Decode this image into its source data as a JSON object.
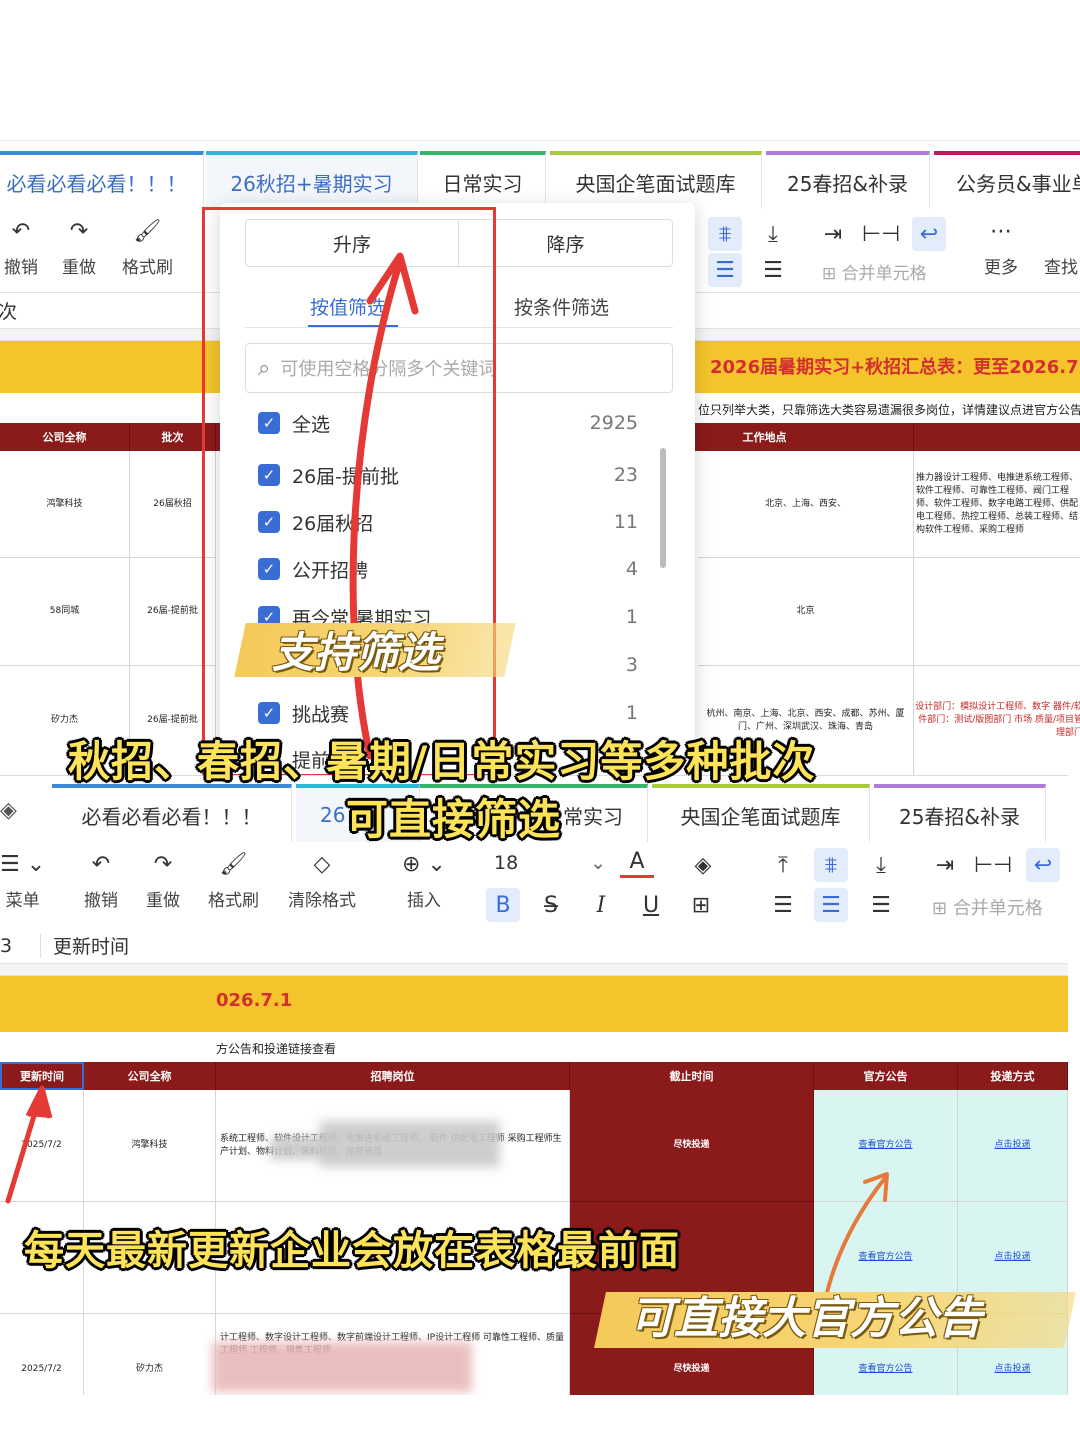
{
  "top_panel": {
    "tabs": [
      {
        "label": "必看必看必看！！！",
        "color": "#3b8bd9"
      },
      {
        "label": "26秋招+暑期实习",
        "color": "#2fb6d8",
        "active": true
      },
      {
        "label": "日常实习",
        "color": "#36b46b"
      },
      {
        "label": "央国企笔面试题库",
        "color": "#a8c93b"
      },
      {
        "label": "25春招&补录",
        "color": "#b07ad8"
      },
      {
        "label": "公务员&事业单",
        "color": "#c2185b"
      }
    ],
    "toolbar": {
      "undo": "撤销",
      "redo": "重做",
      "format_painter": "格式刷",
      "merge_cells": "合并单元格",
      "more": "更多",
      "find": "查找"
    },
    "formula_text": "次",
    "title_banner": "2026届暑期实习+秋招汇总表：更至2026.7.",
    "subtitle": "位只列举大类，只靠筛选大类容易遗漏很多岗位，详情建议点进官方公告和投",
    "headers": [
      "公司全称",
      "批次",
      "工作地点"
    ],
    "rows": [
      {
        "company": "鸿擎科技",
        "batch": "26届秋招",
        "location": "北京、上海、西安、",
        "jobs": "推力器设计工程师、电推进系统工程师、软件工程师、可靠性工程师、阀门工程师、软件工程师、数字电路工程师、供配电工程师、热控工程师、总装工程师、结构软件工程师、采购工程师"
      },
      {
        "company": "58同城",
        "batch": "26届-提前批",
        "location": "北京",
        "jobs": ""
      },
      {
        "company": "矽力杰",
        "batch": "26届-提前批",
        "location": "杭州、南京、上海、北京、西安、成都、苏州、厦门、广州、深圳武汉、珠海、青岛",
        "jobs": "设计部门：模拟设计工程师、数字 器件/软件部门：测试/版图部门 市场 质量/项目管理部门"
      }
    ],
    "filter_popup": {
      "sort_asc": "升序",
      "sort_desc": "降序",
      "tab_by_value": "按值筛选",
      "tab_by_condition": "按条件筛选",
      "search_placeholder": "可使用空格分隔多个关键词",
      "items": [
        {
          "label": "全选",
          "count": "2925"
        },
        {
          "label": "26届-提前批",
          "count": "23"
        },
        {
          "label": "26届秋招",
          "count": "11"
        },
        {
          "label": "公开招聘",
          "count": "4"
        },
        {
          "label": "再今常/暑期实习",
          "count": "1"
        },
        {
          "label": "",
          "count": "3"
        },
        {
          "label": "挑战赛",
          "count": "1"
        },
        {
          "label": "提前",
          "count": ""
        }
      ]
    },
    "overlay_ribbon": "支持筛选"
  },
  "bottom_panel": {
    "tabs": [
      {
        "label": "必看必看必看！！！",
        "color": "#3b8bd9"
      },
      {
        "label": "26",
        "color": "#2fb6d8",
        "active": true
      },
      {
        "label": "常实习",
        "color": "#36b46b"
      },
      {
        "label": "央国企笔面试题库",
        "color": "#a8c93b"
      },
      {
        "label": "25春招&补录",
        "color": "#b07ad8"
      }
    ],
    "toolbar": {
      "menu": "菜单",
      "undo": "撤销",
      "redo": "重做",
      "format_painter": "格式刷",
      "clear_format": "清除格式",
      "insert": "插入",
      "font_size": "18",
      "merge_cells": "合并单元格"
    },
    "cell_ref": "3",
    "formula_text": "更新时间",
    "title_banner": "026.7.1",
    "subtitle": "方公告和投递链接查看",
    "headers": [
      "更新时间",
      "公司全称",
      "招聘岗位",
      "截止时间",
      "官方公告",
      "投递方式"
    ],
    "rows": [
      {
        "date": "2025/7/2",
        "company": "鸿擎科技",
        "jobs": "系统工程师、软件设计工程师、电推进系统工程师、 软件 供配电工程师 采购工程师生产计划、物料计划、来料检验、库房管理",
        "deadline": "尽快投递",
        "notice": "查看官方公告",
        "apply": "点击投递"
      },
      {
        "date": "2",
        "company": "",
        "jobs": "",
        "deadline": "",
        "notice": "查看官方公告",
        "apply": "点击投递"
      },
      {
        "date": "2025/7/2",
        "company": "矽力杰",
        "jobs": "计工程师、数字设计工程师、数字前端设计工程师、IP设计工程师 可靠性工程师、质量工程师 工程师、销售工程师",
        "deadline": "尽快投递",
        "notice": "查看官方公告",
        "apply": "点击投递"
      }
    ]
  },
  "captions": {
    "batches": "秋招、春招、暑期/日常实习等多种批次",
    "filter_direct": "可直接筛选",
    "newest_first": "每天最新更新企业会放在表格最前面",
    "official": "可直接大官方公告"
  }
}
